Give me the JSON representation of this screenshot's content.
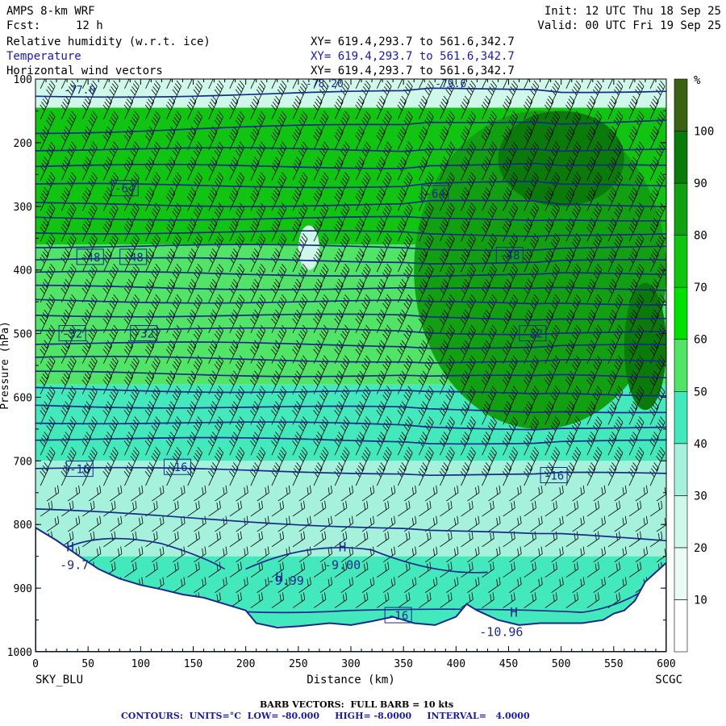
{
  "header": {
    "model": "AMPS 8-km WRF",
    "fcst_label": "Fcst:",
    "fcst_value": "12 h",
    "init": "Init: 12 UTC Thu 18 Sep 25",
    "valid": "Valid: 00 UTC Fri 19 Sep 25",
    "fields": [
      {
        "name": "Relative humidity (w.r.t. ice)",
        "xy": "XY= 619.4,293.7 to 561.6,342.7",
        "color": "#000000"
      },
      {
        "name": "Temperature",
        "xy": "XY= 619.4,293.7 to 561.6,342.7",
        "color": "#1a1aa8"
      },
      {
        "name": "Horizontal wind vectors",
        "xy": "XY= 619.4,293.7 to 561.6,342.7",
        "color": "#000000"
      }
    ]
  },
  "footer": {
    "barb_line": "BARB VECTORS:  FULL BARB = 10 kts",
    "contour_line": "CONTOURS:  UNITS=°C  LOW= -80.000     HIGH= -8.0000     INTERVAL=   4.0000"
  },
  "chart_data": {
    "type": "heatmap",
    "xlabel": "Distance (km)",
    "ylabel": "Pressure (hPa)",
    "xlim": [
      0,
      600
    ],
    "ylim": [
      1000,
      100
    ],
    "x_ticks": [
      0,
      50,
      100,
      150,
      200,
      250,
      300,
      350,
      400,
      450,
      500,
      550,
      600
    ],
    "y_ticks": [
      100,
      200,
      300,
      400,
      500,
      600,
      700,
      800,
      900,
      1000
    ],
    "left_endpoint": "SKY_BLU",
    "right_endpoint": "SCGC",
    "colorbar": {
      "unit": "%",
      "levels": [
        10,
        20,
        30,
        40,
        50,
        60,
        70,
        80,
        90,
        100
      ],
      "colors": [
        "#ffffff",
        "#eafaf5",
        "#cff8ea",
        "#a6f1dc",
        "#44e8bd",
        "#52e466",
        "#00e000",
        "#12c412",
        "#12a012",
        "#0a7a0a",
        "#3a6212"
      ]
    },
    "rh_regions": [
      {
        "x": [
          0,
          600
        ],
        "p": [
          100,
          145
        ],
        "rh": 20
      },
      {
        "x": [
          0,
          600
        ],
        "p": [
          145,
          360
        ],
        "rh": 72
      },
      {
        "x": [
          0,
          600
        ],
        "p": [
          360,
          580
        ],
        "rh": 55
      },
      {
        "x": [
          0,
          600
        ],
        "p": [
          580,
          700
        ],
        "rh": 48
      },
      {
        "x": [
          0,
          600
        ],
        "p": [
          700,
          850
        ],
        "rh": 35
      },
      {
        "x": [
          0,
          600
        ],
        "p": [
          850,
          960
        ],
        "rh": 40
      },
      {
        "x": [
          360,
          600
        ],
        "p": [
          150,
          650
        ],
        "rh": 82
      },
      {
        "x": [
          440,
          560
        ],
        "p": [
          150,
          300
        ],
        "rh": 90
      },
      {
        "x": [
          470,
          540
        ],
        "p": [
          155,
          220
        ],
        "rh": 98
      },
      {
        "x": [
          250,
          270
        ],
        "p": [
          330,
          400
        ],
        "rh": 28
      },
      {
        "x": [
          560,
          600
        ],
        "p": [
          420,
          620
        ],
        "rh": 95
      }
    ],
    "temperature_isotherms": {
      "interval": 4,
      "low": -80,
      "high": -8,
      "labeled": [
        {
          "value": -64,
          "labels": [
            {
              "x": 85,
              "p": 272
            },
            {
              "x": 380,
              "p": 280
            }
          ]
        },
        {
          "value": -48,
          "labels": [
            {
              "x": 52,
              "p": 380
            },
            {
              "x": 93,
              "p": 380
            },
            {
              "x": 451,
              "p": 377
            }
          ]
        },
        {
          "value": -32,
          "labels": [
            {
              "x": 35,
              "p": 500
            },
            {
              "x": 103,
              "p": 500
            },
            {
              "x": 473,
              "p": 500
            }
          ]
        },
        {
          "value": -16,
          "labels": [
            {
              "x": 42,
              "p": 713
            },
            {
              "x": 135,
              "p": 710
            },
            {
              "x": 493,
              "p": 723
            }
          ]
        },
        {
          "value": -16,
          "labels": [
            {
              "x": 345,
              "p": 943
            }
          ]
        }
      ],
      "levels_p_left": [
        127,
        183,
        210,
        237,
        267,
        297,
        318,
        340,
        362,
        383,
        405,
        427,
        448,
        470,
        492,
        515,
        538,
        562,
        587,
        612,
        638,
        665,
        712,
        778
      ],
      "levels_p_right": [
        117,
        165,
        213,
        238,
        268,
        298,
        320,
        343,
        365,
        387,
        408,
        430,
        452,
        475,
        498,
        520,
        545,
        568,
        595,
        622,
        648,
        670,
        722,
        825
      ]
    },
    "top_labels": [
      {
        "text": "-77.0",
        "x": 42,
        "p": 110
      },
      {
        "text": "-78.20",
        "x": 275,
        "p": 100
      },
      {
        "text": "-79.6",
        "x": 395,
        "p": 100
      }
    ],
    "extrema": [
      {
        "type": "H",
        "x": 33,
        "p": 842,
        "value": "-9.7",
        "value_x": 37,
        "value_p": 870
      },
      {
        "type": "H",
        "x": 292,
        "p": 842,
        "value": "-9.00",
        "value_x": 292,
        "value_p": 870
      },
      {
        "type": "H",
        "x": 232,
        "p": 890,
        "value": "-9.99",
        "value_x": 238,
        "value_p": 895
      },
      {
        "type": "H",
        "x": 455,
        "p": 945,
        "value": "-10.96",
        "value_x": 443,
        "value_p": 975
      }
    ],
    "terrain_p": [
      [
        0,
        805
      ],
      [
        20,
        825
      ],
      [
        40,
        848
      ],
      [
        60,
        870
      ],
      [
        80,
        885
      ],
      [
        100,
        895
      ],
      [
        120,
        902
      ],
      [
        140,
        910
      ],
      [
        160,
        915
      ],
      [
        180,
        925
      ],
      [
        200,
        935
      ],
      [
        210,
        955
      ],
      [
        230,
        962
      ],
      [
        250,
        960
      ],
      [
        280,
        955
      ],
      [
        300,
        958
      ],
      [
        320,
        952
      ],
      [
        340,
        945
      ],
      [
        360,
        955
      ],
      [
        380,
        958
      ],
      [
        400,
        945
      ],
      [
        410,
        925
      ],
      [
        420,
        935
      ],
      [
        440,
        950
      ],
      [
        460,
        958
      ],
      [
        480,
        955
      ],
      [
        500,
        955
      ],
      [
        520,
        955
      ],
      [
        540,
        950
      ],
      [
        550,
        940
      ],
      [
        560,
        935
      ],
      [
        570,
        920
      ],
      [
        580,
        890
      ],
      [
        590,
        875
      ],
      [
        600,
        860
      ]
    ],
    "barbs": {
      "upper_direction": "westerly",
      "upper_speed_kts": 45,
      "lower_direction": "northwesterly",
      "lower_speed_kts": 20
    }
  }
}
